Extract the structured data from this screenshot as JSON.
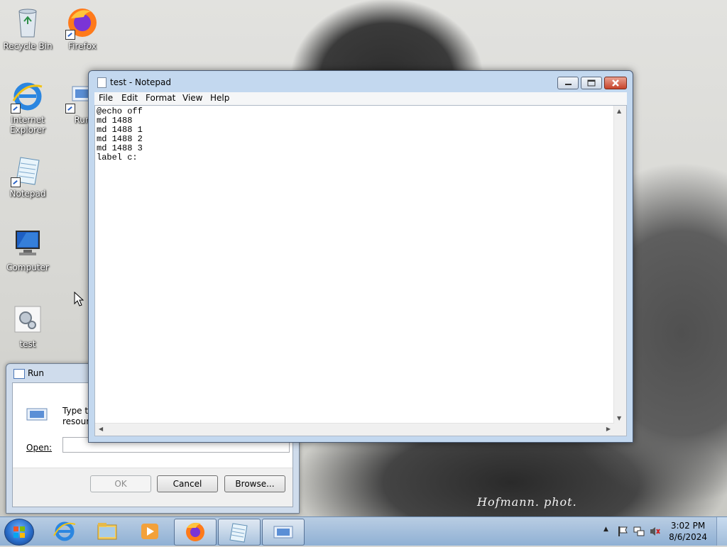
{
  "desktop": {
    "icons": [
      {
        "label": "Recycle Bin",
        "icon": "recycle-bin-icon"
      },
      {
        "label": "Firefox",
        "icon": "firefox-icon"
      },
      {
        "label": "Internet Explorer",
        "icon": "internet-explorer-icon"
      },
      {
        "label": "Run",
        "icon": "run-icon"
      },
      {
        "label": "Notepad",
        "icon": "notepad-icon"
      },
      {
        "label": "Computer",
        "icon": "computer-icon"
      },
      {
        "label": "test",
        "icon": "batch-file-icon"
      }
    ],
    "wallpaper_caption": "Hofmann. phot."
  },
  "notepad": {
    "title": "test - Notepad",
    "menu": [
      "File",
      "Edit",
      "Format",
      "View",
      "Help"
    ],
    "content": "@echo off\nmd 1488\nmd 1488 1\nmd 1488 2\nmd 1488 3\nlabel c:",
    "colors": {
      "titlebar": "#c3d8ef",
      "close_button": "#c7432a"
    }
  },
  "run_dialog": {
    "title": "Run",
    "description_line1": "Type the",
    "description_line2": "resource",
    "open_label": "Open:",
    "open_value": "",
    "buttons": {
      "ok": "OK",
      "cancel": "Cancel",
      "browse": "Browse..."
    }
  },
  "taskbar": {
    "pinned": [
      "internet-explorer-icon",
      "folder-icon",
      "media-player-icon",
      "firefox-icon",
      "notepad-icon",
      "run-icon"
    ],
    "clock_time": "3:02 PM",
    "clock_date": "8/6/2024",
    "tray_icons": [
      "show-hidden-icons-chevron",
      "action-center-flag-icon",
      "network-icon",
      "volume-muted-icon"
    ]
  }
}
